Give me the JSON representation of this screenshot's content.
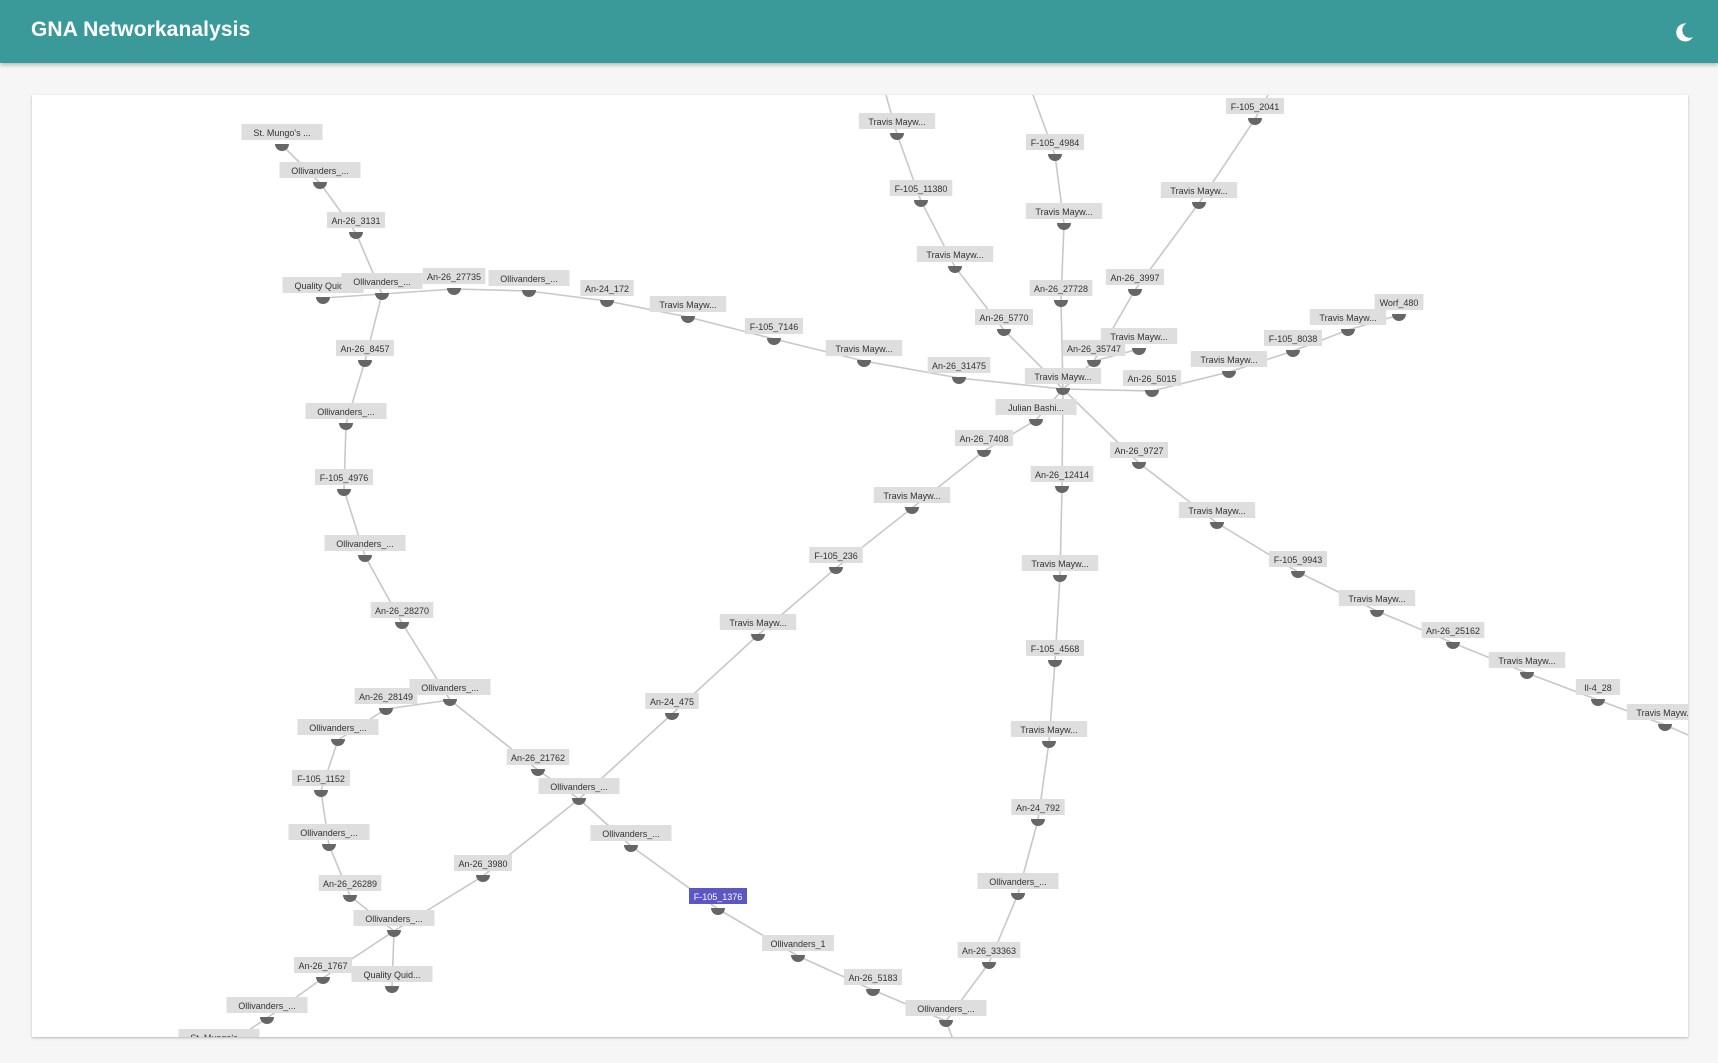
{
  "app": {
    "title": "GNA Networkanalysis",
    "theme_toggle_icon": "moon-icon",
    "accent_color": "#3a9a99",
    "selected_color": "#5b57c4"
  },
  "graph": {
    "nodes": [
      {
        "id": "n1",
        "label": "St. Mungo's ..."
      },
      {
        "id": "n2",
        "label": "Ollivanders_..."
      },
      {
        "id": "n3",
        "label": "An-26_3131"
      },
      {
        "id": "n4",
        "label": "Quality Quid..."
      },
      {
        "id": "n5",
        "label": "Ollivanders_..."
      },
      {
        "id": "n6",
        "label": "An-26_27735"
      },
      {
        "id": "n7",
        "label": "Ollivanders_..."
      },
      {
        "id": "n8",
        "label": "An-24_172"
      },
      {
        "id": "n9",
        "label": "Travis Mayw..."
      },
      {
        "id": "n10",
        "label": "F-105_7146"
      },
      {
        "id": "n11",
        "label": "Travis Mayw..."
      },
      {
        "id": "n12",
        "label": "An-26_31475"
      },
      {
        "id": "hub",
        "label": "Travis Mayw..."
      },
      {
        "id": "n14",
        "label": "An-26_8457"
      },
      {
        "id": "n15",
        "label": "Ollivanders_..."
      },
      {
        "id": "n16",
        "label": "F-105_4976"
      },
      {
        "id": "n17",
        "label": "Ollivanders_..."
      },
      {
        "id": "n18",
        "label": "An-26_28270"
      },
      {
        "id": "n19",
        "label": "Ollivanders_..."
      },
      {
        "id": "n20",
        "label": "An-26_28149"
      },
      {
        "id": "n21",
        "label": "Ollivanders_..."
      },
      {
        "id": "n22",
        "label": "F-105_1152"
      },
      {
        "id": "n23",
        "label": "Ollivanders_..."
      },
      {
        "id": "n24",
        "label": "An-26_26289"
      },
      {
        "id": "n25",
        "label": "Ollivanders_..."
      },
      {
        "id": "n26",
        "label": "An-26_1767"
      },
      {
        "id": "n27",
        "label": "Quality Quid..."
      },
      {
        "id": "n28",
        "label": "Ollivanders_..."
      },
      {
        "id": "n29",
        "label": "St. Mungo's ..."
      },
      {
        "id": "n30",
        "label": "An-26_3980"
      },
      {
        "id": "n31",
        "label": "An-26_21762"
      },
      {
        "id": "n32",
        "label": "Ollivanders_..."
      },
      {
        "id": "n33",
        "label": "Ollivanders_..."
      },
      {
        "id": "n34",
        "label": "F-105_1376",
        "selected": true
      },
      {
        "id": "n35",
        "label": "Ollivanders_1"
      },
      {
        "id": "n36",
        "label": "An-26_5183"
      },
      {
        "id": "n37",
        "label": "Ollivanders_..."
      },
      {
        "id": "n38",
        "label": "An-26_33363"
      },
      {
        "id": "n39",
        "label": "Ollivanders_..."
      },
      {
        "id": "n40",
        "label": "An-24_792"
      },
      {
        "id": "n41",
        "label": "Travis Mayw..."
      },
      {
        "id": "n42",
        "label": "F-105_4568"
      },
      {
        "id": "n43",
        "label": "Travis Mayw..."
      },
      {
        "id": "n44",
        "label": "An-26_12414"
      },
      {
        "id": "n45",
        "label": "An-24_475"
      },
      {
        "id": "n46",
        "label": "Travis Mayw..."
      },
      {
        "id": "n47",
        "label": "F-105_236"
      },
      {
        "id": "n48",
        "label": "Travis Mayw..."
      },
      {
        "id": "n49",
        "label": "An-26_7408"
      },
      {
        "id": "n50",
        "label": "Julian Bashi..."
      },
      {
        "id": "n51",
        "label": "An-26_5770"
      },
      {
        "id": "n52",
        "label": "Travis Mayw..."
      },
      {
        "id": "n53",
        "label": "F-105_11380"
      },
      {
        "id": "n54",
        "label": "Travis Mayw..."
      },
      {
        "id": "n55",
        "label": "An-26_27728"
      },
      {
        "id": "n56",
        "label": "Travis Mayw..."
      },
      {
        "id": "n57",
        "label": "F-105_4984"
      },
      {
        "id": "n58",
        "label": "An-26_35747"
      },
      {
        "id": "n59",
        "label": "An-26_3997"
      },
      {
        "id": "n60",
        "label": "Travis Mayw..."
      },
      {
        "id": "n61",
        "label": "F-105_2041"
      },
      {
        "id": "n62",
        "label": "Travis Mayw..."
      },
      {
        "id": "n63",
        "label": "An-26_5015"
      },
      {
        "id": "n64",
        "label": "Travis Mayw..."
      },
      {
        "id": "n65",
        "label": "F-105_8038"
      },
      {
        "id": "n66",
        "label": "Travis Mayw..."
      },
      {
        "id": "n67",
        "label": "Worf_480"
      },
      {
        "id": "n68",
        "label": "An-26_9727"
      },
      {
        "id": "n69",
        "label": "Travis Mayw..."
      },
      {
        "id": "n70",
        "label": "F-105_9943"
      },
      {
        "id": "n71",
        "label": "Travis Mayw..."
      },
      {
        "id": "n72",
        "label": "An-26_25162"
      },
      {
        "id": "n73",
        "label": "Travis Mayw..."
      },
      {
        "id": "n74",
        "label": "Il-4_28"
      },
      {
        "id": "n75",
        "label": "Travis Mayw..."
      }
    ],
    "edges": [
      [
        "n1",
        "n2"
      ],
      [
        "n2",
        "n3"
      ],
      [
        "n3",
        "n5"
      ],
      [
        "n4",
        "n5"
      ],
      [
        "n5",
        "n6"
      ],
      [
        "n6",
        "n7"
      ],
      [
        "n7",
        "n8"
      ],
      [
        "n8",
        "n9"
      ],
      [
        "n9",
        "n10"
      ],
      [
        "n10",
        "n11"
      ],
      [
        "n11",
        "n12"
      ],
      [
        "n12",
        "hub"
      ],
      [
        "n5",
        "n14"
      ],
      [
        "n14",
        "n15"
      ],
      [
        "n15",
        "n16"
      ],
      [
        "n16",
        "n17"
      ],
      [
        "n17",
        "n18"
      ],
      [
        "n18",
        "n19"
      ],
      [
        "n19",
        "n20"
      ],
      [
        "n20",
        "n21"
      ],
      [
        "n21",
        "n22"
      ],
      [
        "n22",
        "n23"
      ],
      [
        "n23",
        "n24"
      ],
      [
        "n24",
        "n25"
      ],
      [
        "n25",
        "n26"
      ],
      [
        "n25",
        "n27"
      ],
      [
        "n26",
        "n28"
      ],
      [
        "n28",
        "n29"
      ],
      [
        "n25",
        "n30"
      ],
      [
        "n30",
        "n32"
      ],
      [
        "n19",
        "n31"
      ],
      [
        "n31",
        "n32"
      ],
      [
        "n32",
        "n33"
      ],
      [
        "n33",
        "n34"
      ],
      [
        "n34",
        "n35"
      ],
      [
        "n35",
        "n36"
      ],
      [
        "n36",
        "n37"
      ],
      [
        "n37",
        "n38"
      ],
      [
        "n37",
        "x_bottom"
      ],
      [
        "n38",
        "n39"
      ],
      [
        "n39",
        "n40"
      ],
      [
        "n40",
        "n41"
      ],
      [
        "n41",
        "n42"
      ],
      [
        "n42",
        "n43"
      ],
      [
        "n43",
        "n44"
      ],
      [
        "n44",
        "hub"
      ],
      [
        "n32",
        "n45"
      ],
      [
        "n45",
        "n46"
      ],
      [
        "n46",
        "n47"
      ],
      [
        "n47",
        "n48"
      ],
      [
        "n48",
        "n49"
      ],
      [
        "n49",
        "n50"
      ],
      [
        "n50",
        "hub"
      ],
      [
        "hub",
        "n51"
      ],
      [
        "n51",
        "n52"
      ],
      [
        "n52",
        "n53"
      ],
      [
        "n53",
        "n54"
      ],
      [
        "n54",
        "x_top1"
      ],
      [
        "hub",
        "n55"
      ],
      [
        "n55",
        "n56"
      ],
      [
        "n56",
        "n57"
      ],
      [
        "n57",
        "x_top2"
      ],
      [
        "hub",
        "n58"
      ],
      [
        "n58",
        "n59"
      ],
      [
        "n59",
        "n60"
      ],
      [
        "n60",
        "n61"
      ],
      [
        "n61",
        "x_top3"
      ],
      [
        "n58",
        "n62"
      ],
      [
        "hub",
        "n63"
      ],
      [
        "n63",
        "n64"
      ],
      [
        "n64",
        "n65"
      ],
      [
        "n65",
        "n66"
      ],
      [
        "n66",
        "n67"
      ],
      [
        "hub",
        "n68"
      ],
      [
        "n68",
        "n69"
      ],
      [
        "n69",
        "n70"
      ],
      [
        "n70",
        "n71"
      ],
      [
        "n71",
        "n72"
      ],
      [
        "n72",
        "n73"
      ],
      [
        "n73",
        "n74"
      ],
      [
        "n74",
        "n75"
      ],
      [
        "n75",
        "x_right"
      ]
    ]
  }
}
